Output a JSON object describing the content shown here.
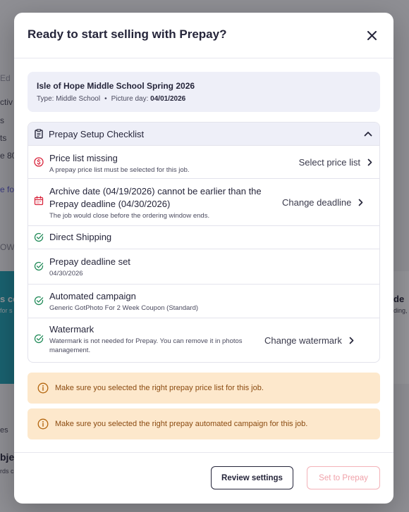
{
  "background": {
    "fragments": [
      "Ed",
      "ctiv",
      "s",
      "ts",
      "e 80",
      "e fo",
      "OW",
      "s co",
      "for s",
      "de",
      "ding,",
      "es",
      "bje",
      "rds c"
    ]
  },
  "modal": {
    "title": "Ready to start selling with Prepay?",
    "close_icon": "close-icon"
  },
  "job": {
    "name": "Isle of Hope Middle School Spring 2026",
    "type_label": "Type: Middle School",
    "separator": "•",
    "picture_day_label": "Picture day:",
    "picture_day": "04/01/2026"
  },
  "checklist": {
    "title": "Prepay Setup Checklist",
    "items": [
      {
        "status": "error",
        "icon": "dollar-circle-icon",
        "title": "Price list missing",
        "subtitle": "A prepay price list must be selected for this job.",
        "action": "Select price list"
      },
      {
        "status": "error",
        "icon": "calendar-icon",
        "title": "Archive date (04/19/2026) cannot be earlier than the Prepay deadline (04/30/2026)",
        "subtitle": "The job would close before the ordering window ends.",
        "action": "Change deadline"
      },
      {
        "status": "ok",
        "icon": "check-circle-icon",
        "title": "Direct Shipping",
        "subtitle": "",
        "action": ""
      },
      {
        "status": "ok",
        "icon": "check-circle-icon",
        "title": "Prepay deadline set",
        "subtitle": "04/30/2026",
        "action": ""
      },
      {
        "status": "ok",
        "icon": "check-circle-icon",
        "title": "Automated campaign",
        "subtitle": "Generic GotPhoto For 2 Week Coupon (Standard)",
        "action": ""
      },
      {
        "status": "ok",
        "icon": "check-circle-icon",
        "title": "Watermark",
        "subtitle": "Watermark is not needed for Prepay. You can remove it in photos management.",
        "action": "Change watermark"
      }
    ]
  },
  "alerts": [
    "Make sure you selected the right prepay price list for this job.",
    "Make sure you selected the right prepay automated campaign for this job."
  ],
  "footer": {
    "review_label": "Review settings",
    "prepay_label": "Set to Prepay"
  },
  "colors": {
    "error": "#d9263d",
    "success": "#1f8a57",
    "warning_bg": "#fde8cc",
    "warning_text": "#8a4a10",
    "accent_bg": "#eeeff8"
  }
}
